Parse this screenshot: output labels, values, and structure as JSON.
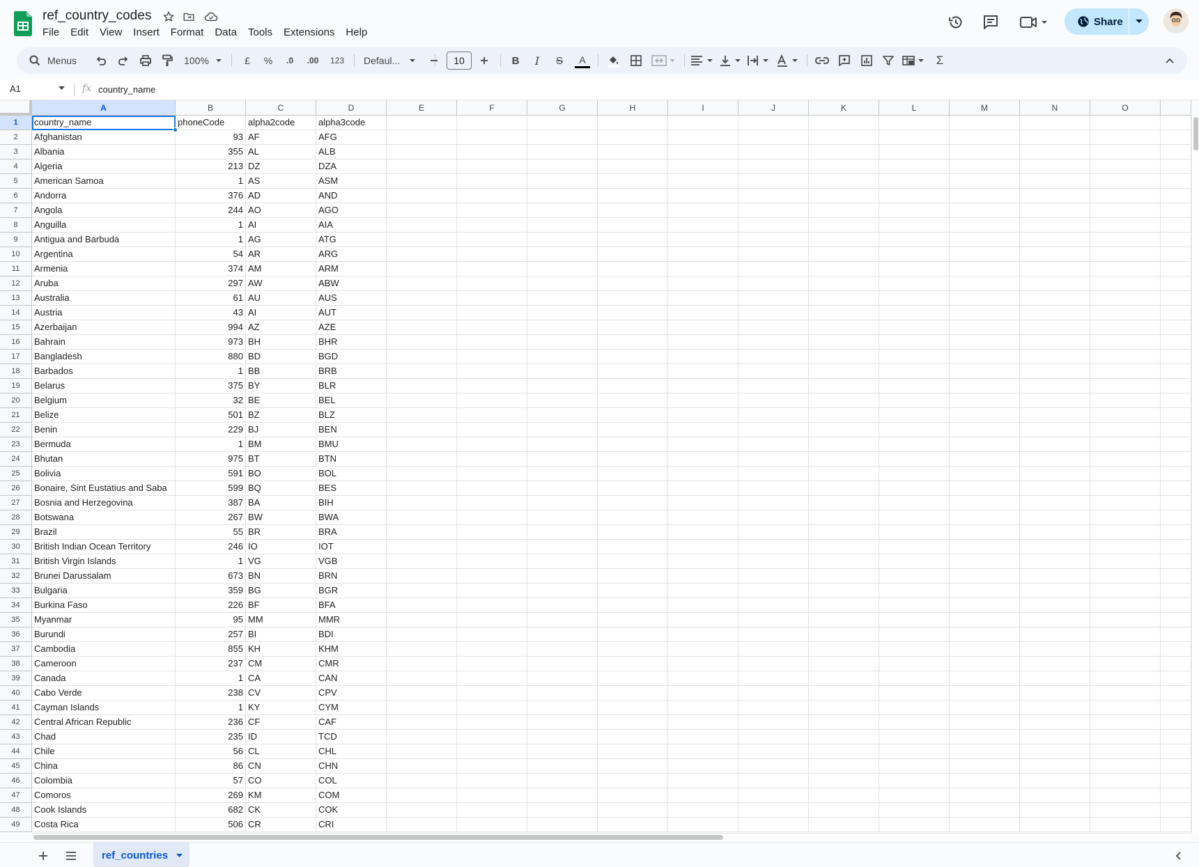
{
  "document": {
    "title": "ref_country_codes",
    "menu": [
      "File",
      "Edit",
      "View",
      "Insert",
      "Format",
      "Data",
      "Tools",
      "Extensions",
      "Help"
    ],
    "share_label": "Share"
  },
  "toolbar": {
    "search_label": "Menus",
    "zoom": "100%",
    "currency": "£",
    "percent": "%",
    "dec_decrease": ".0",
    "dec_increase": ".00",
    "number_format": "123",
    "font": "Defaul...",
    "font_size": "10",
    "bold": "B",
    "italic": "I",
    "strike": "S",
    "text_color": "A"
  },
  "formula_bar": {
    "cell_ref": "A1",
    "fx": "fx",
    "value": "country_name"
  },
  "columns": [
    "A",
    "B",
    "C",
    "D",
    "E",
    "F",
    "G",
    "H",
    "I",
    "J",
    "K",
    "L",
    "M",
    "N",
    "O"
  ],
  "rows": [
    [
      "country_name",
      "phoneCode",
      "alpha2code",
      "alpha3code"
    ],
    [
      "Afghanistan",
      "93",
      "AF",
      "AFG"
    ],
    [
      "Albania",
      "355",
      "AL",
      "ALB"
    ],
    [
      "Algeria",
      "213",
      "DZ",
      "DZA"
    ],
    [
      "American Samoa",
      "1",
      "AS",
      "ASM"
    ],
    [
      "Andorra",
      "376",
      "AD",
      "AND"
    ],
    [
      "Angola",
      "244",
      "AO",
      "AGO"
    ],
    [
      "Anguilla",
      "1",
      "AI",
      "AIA"
    ],
    [
      "Antigua and Barbuda",
      "1",
      "AG",
      "ATG"
    ],
    [
      "Argentina",
      "54",
      "AR",
      "ARG"
    ],
    [
      "Armenia",
      "374",
      "AM",
      "ARM"
    ],
    [
      "Aruba",
      "297",
      "AW",
      "ABW"
    ],
    [
      "Australia",
      "61",
      "AU",
      "AUS"
    ],
    [
      "Austria",
      "43",
      "AI",
      "AUT"
    ],
    [
      "Azerbaijan",
      "994",
      "AZ",
      "AZE"
    ],
    [
      "Bahrain",
      "973",
      "BH",
      "BHR"
    ],
    [
      "Bangladesh",
      "880",
      "BD",
      "BGD"
    ],
    [
      "Barbados",
      "1",
      "BB",
      "BRB"
    ],
    [
      "Belarus",
      "375",
      "BY",
      "BLR"
    ],
    [
      "Belgium",
      "32",
      "BE",
      "BEL"
    ],
    [
      "Belize",
      "501",
      "BZ",
      "BLZ"
    ],
    [
      "Benin",
      "229",
      "BJ",
      "BEN"
    ],
    [
      "Bermuda",
      "1",
      "BM",
      "BMU"
    ],
    [
      "Bhutan",
      "975",
      "BT",
      "BTN"
    ],
    [
      "Bolivia",
      "591",
      "BO",
      "BOL"
    ],
    [
      "Bonaire, Sint Eustatius and Saba",
      "599",
      "BQ",
      "BES"
    ],
    [
      "Bosnia and Herzegovina",
      "387",
      "BA",
      "BIH"
    ],
    [
      "Botswana",
      "267",
      "BW",
      "BWA"
    ],
    [
      "Brazil",
      "55",
      "BR",
      "BRA"
    ],
    [
      "British Indian Ocean Territory",
      "246",
      "IO",
      "IOT"
    ],
    [
      "British Virgin Islands",
      "1",
      "VG",
      "VGB"
    ],
    [
      "Brunei Darussalam",
      "673",
      "BN",
      "BRN"
    ],
    [
      "Bulgaria",
      "359",
      "BG",
      "BGR"
    ],
    [
      "Burkina Faso",
      "226",
      "BF",
      "BFA"
    ],
    [
      "Myanmar",
      "95",
      "MM",
      "MMR"
    ],
    [
      "Burundi",
      "257",
      "BI",
      "BDI"
    ],
    [
      "Cambodia",
      "855",
      "KH",
      "KHM"
    ],
    [
      "Cameroon",
      "237",
      "CM",
      "CMR"
    ],
    [
      "Canada",
      "1",
      "CA",
      "CAN"
    ],
    [
      "Cabo Verde",
      "238",
      "CV",
      "CPV"
    ],
    [
      "Cayman Islands",
      "1",
      "KY",
      "CYM"
    ],
    [
      "Central African Republic",
      "236",
      "CF",
      "CAF"
    ],
    [
      "Chad",
      "235",
      "ID",
      "TCD"
    ],
    [
      "Chile",
      "56",
      "CL",
      "CHL"
    ],
    [
      "China",
      "86",
      "CN",
      "CHN"
    ],
    [
      "Colombia",
      "57",
      "CO",
      "COL"
    ],
    [
      "Comoros",
      "269",
      "KM",
      "COM"
    ],
    [
      "Cook Islands",
      "682",
      "CK",
      "COK"
    ],
    [
      "Costa Rica",
      "506",
      "CR",
      "CRI"
    ]
  ],
  "sheet_tab": "ref_countries",
  "colors": {
    "accent": "#1a73e8",
    "share_bg": "#c2e7ff",
    "toolbar_bg": "#edf2fa",
    "sheets_green": "#0f9d58"
  }
}
